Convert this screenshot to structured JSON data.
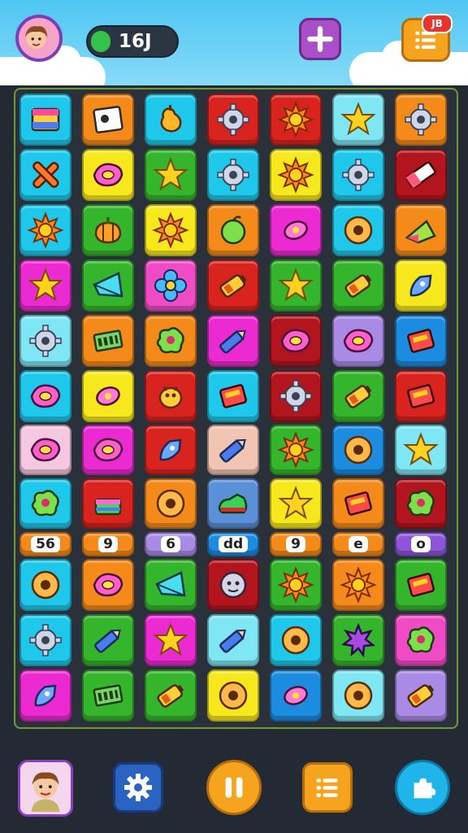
{
  "header": {
    "score": "16J",
    "notification_badge": "JB",
    "colors": {
      "sky": "#4fc6f2",
      "add_button": "#a94fc9",
      "menu_button": "#f6a41d"
    }
  },
  "tile_colors": {
    "c": "#1fc8ea",
    "b": "#1c8ce0",
    "o": "#f48a1a",
    "y": "#f6e81c",
    "r": "#d8231e",
    "dr": "#b2151e",
    "m": "#ec2ad2",
    "p": "#ef4bc4",
    "g": "#35b52b",
    "lc": "#7fe6f4",
    "lv": "#a98be6",
    "pk": "#f6c7e0",
    "pe": "#f2c5b2",
    "lb": "#5a90d8",
    "vi": "#8d56d8"
  },
  "board": {
    "rows": [
      [
        "c:flag-icon",
        "o:picture-icon",
        "c:pear-icon",
        "r:gear-icon",
        "r:sun-icon",
        "lc:star-icon",
        "o:gear-icon"
      ],
      [
        "c:cross-icon",
        "y:gem-icon",
        "g:star-icon",
        "c:gear-icon",
        "y:sun-icon",
        "c:gear-icon",
        "dr:eraser-icon"
      ],
      [
        "c:sun-icon",
        "g:pumpkin-icon",
        "y:sun-icon",
        "o:apple-icon",
        "m:candy-icon",
        "c:donut-icon",
        "o:cheese-icon"
      ],
      [
        "m:star-icon",
        "g:kite-icon",
        "p:flower-icon",
        "r:battery-icon",
        "g:star-icon",
        "g:battery-icon",
        "y:rocket-icon"
      ],
      [
        "lc:gear-icon",
        "o:film-icon",
        "o:blob-icon",
        "m:crayon-icon",
        "dr:gem-icon",
        "lv:gem-icon",
        "b:box-icon"
      ],
      [
        "c:gem-icon",
        "y:candy-icon",
        "r:bug-icon",
        "c:box-icon",
        "dr:gear-icon",
        "g:battery-icon",
        "r:box-icon"
      ],
      [
        "pk:gem-icon",
        "m:gem-icon",
        "r:rocket-icon",
        "pe:crayon-icon",
        "g:sun-icon",
        "b:donut-icon",
        "lc:star-icon"
      ],
      [
        "c:blob-icon",
        "r:cake-icon",
        "o:donut-icon",
        "lb:shoe-icon",
        "y:star-icon",
        "o:box-icon",
        "dr:blob-icon"
      ],
      [
        "o:text-56",
        "o:text-9",
        "lv:text-6",
        "b:text-dd",
        "o:text-9",
        "o:text-e",
        "vi:text-o"
      ],
      [
        "c:donut-icon",
        "o:gem-icon",
        "g:kite-icon",
        "dr:face-icon",
        "g:sun-icon",
        "o:sun-icon",
        "g:box-icon"
      ],
      [
        "c:gear-icon",
        "g:crayon-icon",
        "m:star-icon",
        "lc:crayon-icon",
        "c:donut-icon",
        "g:splat-icon",
        "p:blob-icon"
      ],
      [
        "m:rocket-icon",
        "g:film-icon",
        "g:battery-icon",
        "y:donut-icon",
        "b:candy-icon",
        "lc:donut-icon",
        "lv:battery-icon"
      ]
    ],
    "mini_labels": {
      "text-56": "56",
      "text-9": "9",
      "text-6": "6",
      "text-dd": "dd",
      "text-e": "e",
      "text-o": "o"
    }
  },
  "footer": {
    "colors": {
      "settings": "#2a63c2",
      "pause": "#f6a41d",
      "list": "#f6a41d",
      "share": "#1fb5ea"
    }
  }
}
